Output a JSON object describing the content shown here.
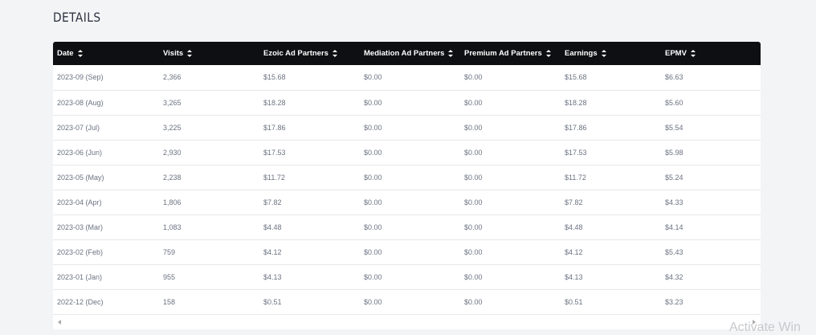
{
  "section_title": "DETAILS",
  "table": {
    "headers": [
      "Date",
      "Visits",
      "Ezoic Ad Partners",
      "Mediation Ad Partners",
      "Premium Ad Partners",
      "Earnings",
      "EPMV"
    ],
    "rows": [
      [
        "2023-09 (Sep)",
        "2,366",
        "$15.68",
        "$0.00",
        "$0.00",
        "$15.68",
        "$6.63"
      ],
      [
        "2023-08 (Aug)",
        "3,265",
        "$18.28",
        "$0.00",
        "$0.00",
        "$18.28",
        "$5.60"
      ],
      [
        "2023-07 (Jul)",
        "3,225",
        "$17.86",
        "$0.00",
        "$0.00",
        "$17.86",
        "$5.54"
      ],
      [
        "2023-06 (Jun)",
        "2,930",
        "$17.53",
        "$0.00",
        "$0.00",
        "$17.53",
        "$5.98"
      ],
      [
        "2023-05 (May)",
        "2,238",
        "$11.72",
        "$0.00",
        "$0.00",
        "$11.72",
        "$5.24"
      ],
      [
        "2023-04 (Apr)",
        "1,806",
        "$7.82",
        "$0.00",
        "$0.00",
        "$7.82",
        "$4.33"
      ],
      [
        "2023-03 (Mar)",
        "1,083",
        "$4.48",
        "$0.00",
        "$0.00",
        "$4.48",
        "$4.14"
      ],
      [
        "2023-02 (Feb)",
        "759",
        "$4.12",
        "$0.00",
        "$0.00",
        "$4.12",
        "$5.43"
      ],
      [
        "2023-01 (Jan)",
        "955",
        "$4.13",
        "$0.00",
        "$0.00",
        "$4.13",
        "$4.32"
      ],
      [
        "2022-12 (Dec)",
        "158",
        "$0.51",
        "$0.00",
        "$0.00",
        "$0.51",
        "$3.23"
      ]
    ]
  },
  "icons": {
    "sort": "sort-icon",
    "scroll_left": "scroll-left-arrow-icon",
    "scroll_right": "scroll-right-arrow-icon"
  },
  "watermark": "Activate Win",
  "colors": {
    "header_bg": "#0d0f12",
    "header_text": "#ffffff",
    "cell_text": "#6b7280",
    "page_bg": "#f3f4f6"
  }
}
